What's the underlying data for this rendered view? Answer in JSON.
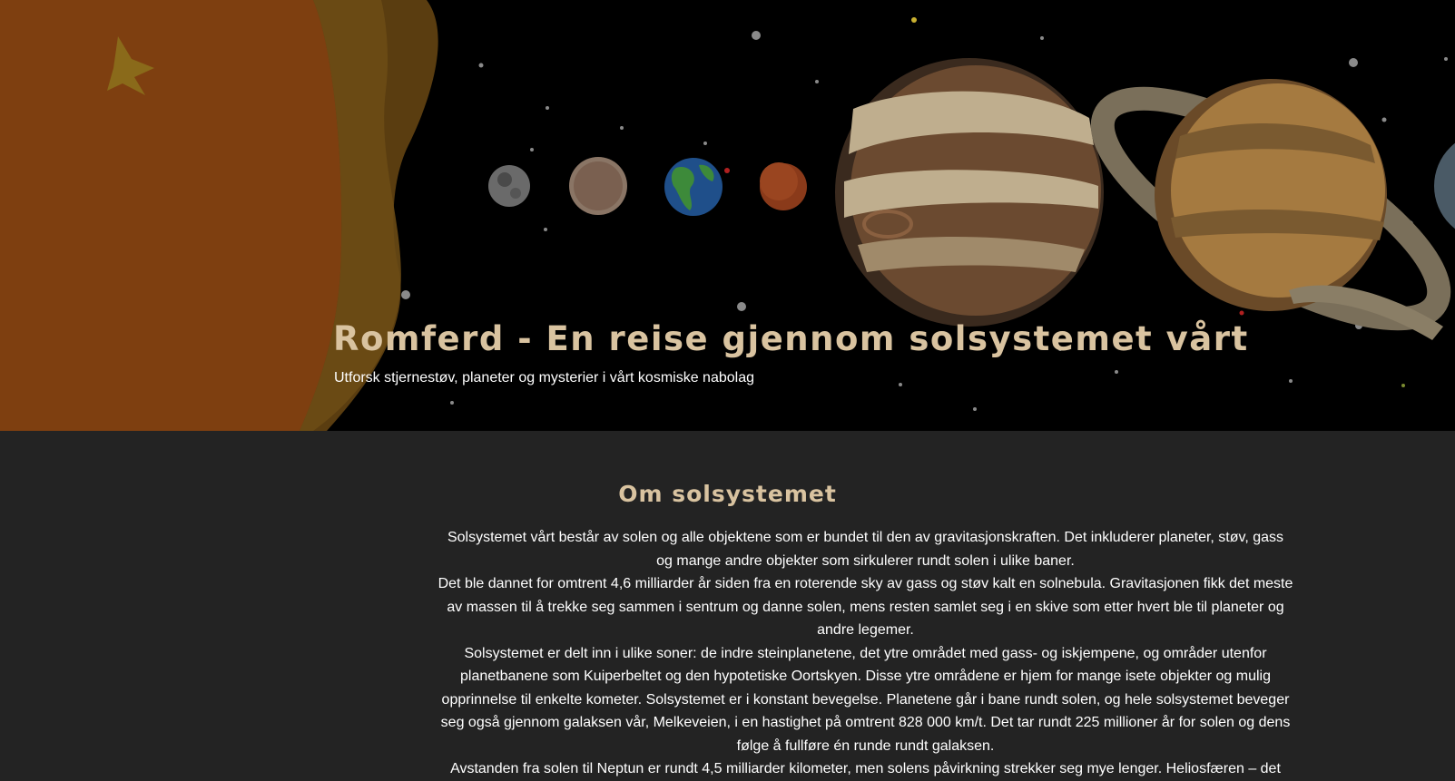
{
  "hero": {
    "title": "Romferd - En reise gjennom solsystemet vårt",
    "subtitle": "Utforsk stjernestøv, planeter og mysterier i vårt kosmiske nabolag"
  },
  "about": {
    "heading": "Om solsystemet",
    "paragraphs": [
      "Solsystemet vårt består av solen og alle objektene som er bundet til den av gravitasjonskraften. Det inkluderer planeter, støv, gass og mange andre objekter som sirkulerer rundt solen i ulike baner.",
      "Det ble dannet for omtrent 4,6 milliarder år siden fra en roterende sky av gass og støv kalt en solnebula. Gravitasjonen fikk det meste av massen til å trekke seg sammen i sentrum og danne solen, mens resten samlet seg i en skive som etter hvert ble til planeter og andre legemer.",
      "Solsystemet er delt inn i ulike soner: de indre steinplanetene, det ytre området med gass- og iskjempene, og områder utenfor planetbanene som Kuiperbeltet og den hypotetiske Oortskyen. Disse ytre områdene er hjem for mange isete objekter og mulig opprinnelse til enkelte kometer. Solsystemet er i konstant bevegelse. Planetene går i bane rundt solen, og hele solsystemet beveger seg også gjennom galaksen vår, Melkeveien, i en hastighet på omtrent 828 000 km/t. Det tar rundt 225 millioner år for solen og dens følge å fullføre én runde rundt galaksen.",
      "Avstanden fra solen til Neptun er rundt 4,5 milliarder kilometer, men solens påvirkning strekker seg mye lenger. Heliosfæren – det"
    ]
  },
  "colors": {
    "heading_accent": "#d9c3a0",
    "page_background": "#232323",
    "hero_background": "#000000"
  }
}
